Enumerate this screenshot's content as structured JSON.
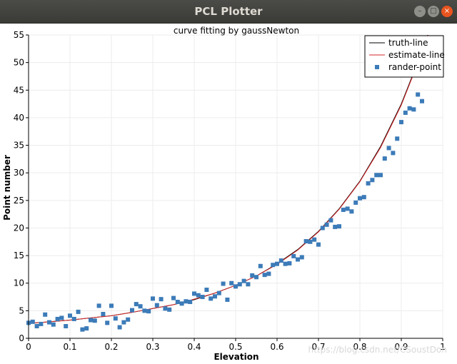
{
  "window": {
    "title": "PCL Plotter",
    "buttons": {
      "minimize": "–",
      "maximize": "□",
      "close": "×"
    },
    "close_color": "#e9541f"
  },
  "watermark": "https://blog.csdn.net/CSoustDon",
  "chart_data": {
    "type": "scatter",
    "title": "curve fitting by gaussNewton",
    "xlabel": "Elevation",
    "ylabel": "Point number",
    "xlim": [
      0,
      1
    ],
    "ylim": [
      0,
      55
    ],
    "xticks": [
      0,
      0.1,
      0.2,
      0.3,
      0.4,
      0.5,
      0.6,
      0.7,
      0.8,
      0.9,
      1
    ],
    "xtick_labels": [
      "0",
      "0.1",
      "0.2",
      "0.3",
      "0.4",
      "0.5",
      "0.6",
      "0.7",
      "0.8",
      "0.9",
      "1"
    ],
    "yticks": [
      0,
      5,
      10,
      15,
      20,
      25,
      30,
      35,
      40,
      45,
      50,
      55
    ],
    "grid": true,
    "legend_position": "top-right",
    "series": [
      {
        "name": "truth-line",
        "kind": "line",
        "color": "#000000",
        "x": [
          0,
          0.05,
          0.1,
          0.15,
          0.2,
          0.25,
          0.3,
          0.35,
          0.4,
          0.45,
          0.5,
          0.55,
          0.6,
          0.65,
          0.7,
          0.75,
          0.8,
          0.85,
          0.9,
          0.95,
          1.0
        ],
        "y": [
          2.7,
          3.0,
          3.3,
          3.7,
          4.1,
          4.7,
          5.4,
          6.1,
          7.0,
          8.2,
          9.6,
          11.3,
          13.5,
          16.1,
          19.4,
          23.5,
          28.5,
          34.8,
          42.5,
          52.0,
          63.0
        ]
      },
      {
        "name": "estimate-line",
        "kind": "line",
        "color": "#d62728",
        "x": [
          0,
          0.05,
          0.1,
          0.15,
          0.2,
          0.25,
          0.3,
          0.35,
          0.4,
          0.45,
          0.5,
          0.55,
          0.6,
          0.65,
          0.7,
          0.75,
          0.8,
          0.85,
          0.9,
          0.95,
          1.0
        ],
        "y": [
          2.7,
          3.0,
          3.3,
          3.7,
          4.1,
          4.7,
          5.4,
          6.1,
          7.1,
          8.2,
          9.6,
          11.3,
          13.4,
          16.0,
          19.3,
          23.4,
          28.4,
          34.6,
          42.3,
          51.8,
          62.8
        ]
      },
      {
        "name": "rander-point",
        "kind": "scatter",
        "color": "#3c7bb8",
        "x": [
          0.0,
          0.01,
          0.02,
          0.03,
          0.04,
          0.05,
          0.06,
          0.07,
          0.08,
          0.09,
          0.1,
          0.11,
          0.12,
          0.13,
          0.14,
          0.15,
          0.16,
          0.17,
          0.18,
          0.19,
          0.2,
          0.21,
          0.22,
          0.23,
          0.24,
          0.25,
          0.26,
          0.27,
          0.28,
          0.29,
          0.3,
          0.31,
          0.32,
          0.33,
          0.34,
          0.35,
          0.36,
          0.37,
          0.38,
          0.39,
          0.4,
          0.41,
          0.42,
          0.43,
          0.44,
          0.45,
          0.46,
          0.47,
          0.48,
          0.49,
          0.5,
          0.51,
          0.52,
          0.53,
          0.54,
          0.55,
          0.56,
          0.57,
          0.58,
          0.59,
          0.6,
          0.61,
          0.62,
          0.63,
          0.64,
          0.65,
          0.66,
          0.67,
          0.68,
          0.69,
          0.7,
          0.71,
          0.72,
          0.73,
          0.74,
          0.75,
          0.76,
          0.77,
          0.78,
          0.79,
          0.8,
          0.81,
          0.82,
          0.83,
          0.84,
          0.85,
          0.86,
          0.87,
          0.88,
          0.89,
          0.9,
          0.91,
          0.92,
          0.93,
          0.94,
          0.95,
          0.96
        ],
        "y": [
          2.8,
          3.0,
          2.2,
          2.6,
          4.3,
          2.9,
          2.5,
          3.5,
          3.7,
          2.2,
          4.1,
          3.5,
          4.8,
          1.6,
          1.8,
          3.3,
          3.2,
          5.9,
          4.4,
          2.8,
          5.9,
          3.6,
          2.0,
          2.9,
          3.4,
          5.1,
          6.2,
          5.8,
          5.0,
          4.9,
          7.2,
          6.0,
          7.1,
          5.4,
          5.2,
          7.3,
          6.6,
          6.3,
          6.7,
          6.6,
          8.1,
          7.8,
          7.5,
          8.8,
          7.2,
          7.6,
          8.2,
          9.9,
          7.0,
          10.0,
          9.4,
          9.8,
          10.4,
          9.8,
          11.4,
          11.1,
          13.1,
          11.5,
          11.7,
          13.3,
          13.5,
          14.1,
          13.5,
          13.6,
          14.9,
          14.3,
          14.7,
          17.6,
          17.5,
          17.9,
          17.0,
          20.0,
          20.6,
          21.4,
          20.2,
          20.3,
          23.3,
          23.5,
          23.0,
          24.6,
          25.4,
          25.6,
          28.1,
          28.7,
          29.6,
          29.6,
          32.6,
          34.5,
          33.6,
          36.2,
          39.2,
          40.9,
          41.7,
          41.5,
          44.2,
          43.0,
          47.9
        ]
      }
    ]
  }
}
